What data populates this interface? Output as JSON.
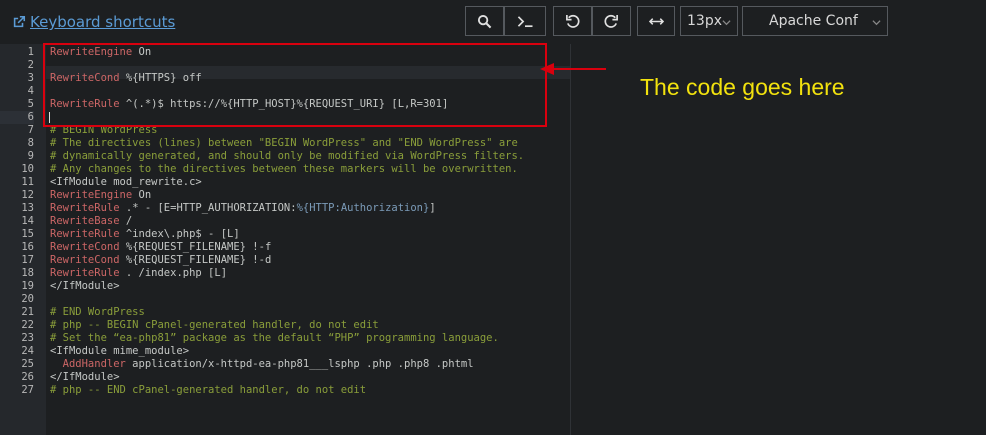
{
  "toolbar": {
    "shortcuts_link": "Keyboard shortcuts",
    "font_size": "13px",
    "mode": "Apache Conf"
  },
  "annotation": {
    "text": "The code goes here"
  },
  "editor": {
    "line_numbers": [
      "1",
      "2",
      "3",
      "4",
      "5",
      "6",
      "7",
      "8",
      "9",
      "10",
      "11",
      "12",
      "13",
      "14",
      "15",
      "16",
      "17",
      "18",
      "19",
      "20",
      "21",
      "22",
      "23",
      "24",
      "25",
      "26",
      "27"
    ]
  },
  "colors": {
    "keyword": "#cc6666",
    "comment": "#8a9e3a",
    "text": "#c5c8c6",
    "variable": "#7b9bb8",
    "highlight_box": "#d9000e",
    "annotation_text": "#f2e20e"
  },
  "icons": [
    "external-link-icon",
    "search-icon",
    "terminal-icon",
    "undo-icon",
    "redo-icon",
    "wrap-icon",
    "chevron-down-icon"
  ],
  "code": {
    "l1": {
      "kw": "RewriteEngine",
      "rest": " On"
    },
    "l3": {
      "kw": "RewriteCond",
      "rest": " %{HTTPS} off"
    },
    "l5": {
      "kw": "RewriteRule",
      "rest": " ^(.*)$ https://%{HTTP_HOST}%{REQUEST_URI} [L,R=301]"
    },
    "l7": "# BEGIN WordPress",
    "l8": "# The directives (lines) between \"BEGIN WordPress\" and \"END WordPress\" are",
    "l9": "# dynamically generated, and should only be modified via WordPress filters.",
    "l10": "# Any changes to the directives between these markers will be overwritten.",
    "l11": "<IfModule mod_rewrite.c>",
    "l12": {
      "kw": "RewriteEngine",
      "rest": " On"
    },
    "l13": {
      "kw": "RewriteRule",
      "rest": " .* - [E=HTTP_AUTHORIZATION:",
      "var": "%{HTTP:Authorization}",
      "tail": "]"
    },
    "l14": {
      "kw": "RewriteBase",
      "rest": " /"
    },
    "l15": {
      "kw": "RewriteRule",
      "rest": " ^index\\.php$ - [L]"
    },
    "l16": {
      "kw": "RewriteCond",
      "rest": " %{REQUEST_FILENAME} !-f"
    },
    "l17": {
      "kw": "RewriteCond",
      "rest": " %{REQUEST_FILENAME} !-d"
    },
    "l18": {
      "kw": "RewriteRule",
      "rest": " . /index.php [L]"
    },
    "l19": "</IfModule>",
    "l21": "# END WordPress",
    "l22": "# php -- BEGIN cPanel-generated handler, do not edit",
    "l23": "# Set the “ea-php81” package as the default “PHP” programming language.",
    "l24": "<IfModule mime_module>",
    "l25": {
      "kw": "  AddHandler",
      "rest": " application/x-httpd-ea-php81___lsphp .php .php8 .phtml"
    },
    "l26": "</IfModule>",
    "l27": "# php -- END cPanel-generated handler, do not edit"
  }
}
